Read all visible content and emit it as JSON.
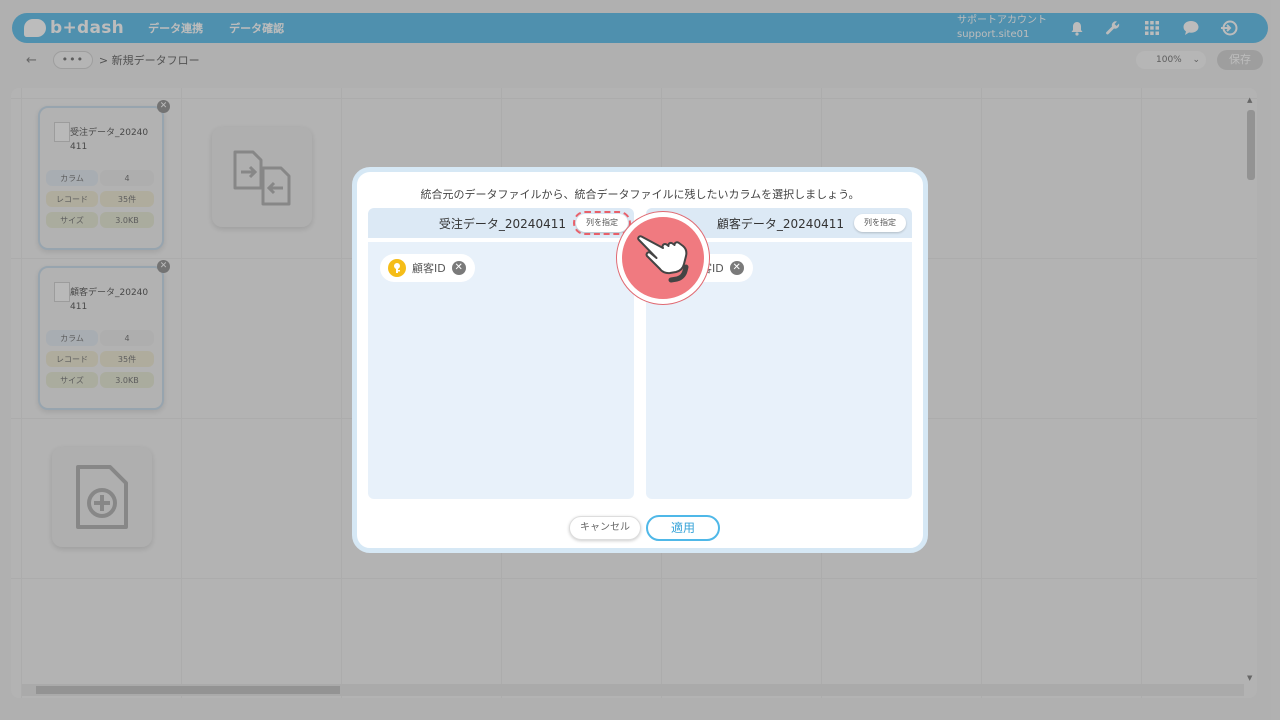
{
  "app": {
    "logo_text": "b+dash",
    "nav": [
      "データ連携",
      "データ確認"
    ],
    "account_label": "サポートアカウント",
    "account_site": "support.site01"
  },
  "subbar": {
    "back": "←",
    "more": "•••",
    "breadcrumb": "> 新規データフロー",
    "zoom": "100%",
    "save": "保存"
  },
  "cards": [
    {
      "name": "受注データ_20240411",
      "stats": [
        {
          "label": "カラム",
          "value": "4"
        },
        {
          "label": "レコード",
          "value": "35件"
        },
        {
          "label": "サイズ",
          "value": "3.0KB"
        }
      ]
    },
    {
      "name": "顧客データ_20240411",
      "stats": [
        {
          "label": "カラム",
          "value": "4"
        },
        {
          "label": "レコード",
          "value": "35件"
        },
        {
          "label": "サイズ",
          "value": "3.0KB"
        }
      ]
    }
  ],
  "modal": {
    "instruction": "統合元のデータファイルから、統合データファイルに残したいカラムを選択しましょう。",
    "left": {
      "title": "受注データ_20240411",
      "button": "列を指定",
      "chips": [
        "顧客ID"
      ]
    },
    "right": {
      "title": "顧客データ_20240411",
      "button": "列を指定",
      "chips": [
        "顧客ID"
      ]
    },
    "cancel": "キャンセル",
    "apply": "適用"
  },
  "colors": {
    "brand": "#4fb8e8",
    "key": "#f5bd18",
    "pointer": "#f07a80"
  }
}
